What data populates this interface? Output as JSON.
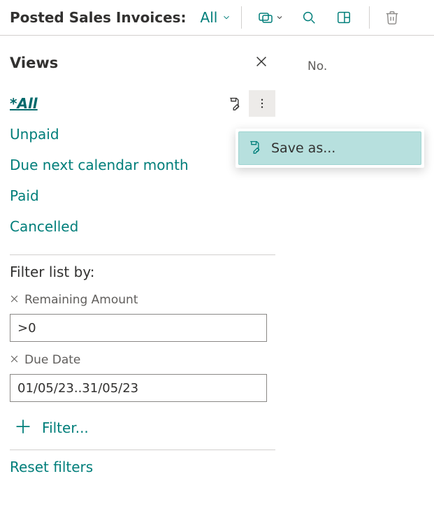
{
  "toolbar": {
    "title": "Posted Sales Invoices:",
    "view_selector": "All"
  },
  "column_header": {
    "no": "No."
  },
  "panel": {
    "views_heading": "Views",
    "views": [
      {
        "label": "All"
      },
      {
        "label": "Unpaid"
      },
      {
        "label": "Due next calendar month"
      },
      {
        "label": "Paid"
      },
      {
        "label": "Cancelled"
      }
    ],
    "filter_heading": "Filter list by:",
    "filters": [
      {
        "label": "Remaining Amount",
        "value": ">0"
      },
      {
        "label": "Due Date",
        "value": "01/05/23..31/05/23"
      }
    ],
    "add_filter_label": "Filter...",
    "reset_label": "Reset filters"
  },
  "dropdown": {
    "save_as": "Save as..."
  }
}
